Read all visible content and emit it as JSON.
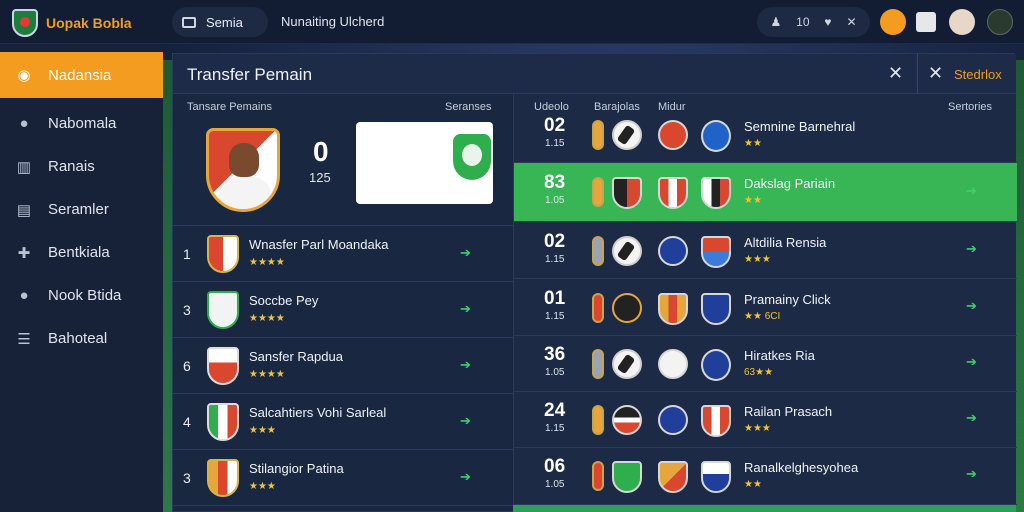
{
  "app": {
    "title": "Uopak Bobla"
  },
  "topbar": {
    "tab_label": "Semia",
    "title": "Nunaiting Ulcherd",
    "counter": "10"
  },
  "sidebar": {
    "items": [
      {
        "label": "Nadansia",
        "icon": "soccer-ball-icon",
        "active": true
      },
      {
        "label": "Nabomala",
        "icon": "person-icon"
      },
      {
        "label": "Ranais",
        "icon": "board-icon"
      },
      {
        "label": "Seramler",
        "icon": "document-icon"
      },
      {
        "label": "Bentkiala",
        "icon": "crossing-arrows-icon"
      },
      {
        "label": "Nook Btida",
        "icon": "person-icon"
      },
      {
        "label": "Bahoteal",
        "icon": "list-icon"
      }
    ]
  },
  "panel": {
    "title": "Transfer Pemain",
    "action_label": "Stedrlox"
  },
  "left": {
    "header": "Tansare Pemains",
    "header_right": "Seranses",
    "featured": {
      "score": "0",
      "sub": "125"
    },
    "rows": [
      {
        "rank": "1",
        "name": "Wnasfer Parl Moandaka",
        "stars": "★★★★"
      },
      {
        "rank": "3",
        "name": "Soccbe Pey",
        "stars": "★★★★"
      },
      {
        "rank": "6",
        "name": "Sansfer Rapdua",
        "stars": "★★★★"
      },
      {
        "rank": "4",
        "name": "Salcahtiers Vohi Sarleal",
        "stars": "★★★"
      },
      {
        "rank": "3",
        "name": "Stilangior Patina",
        "stars": "★★★"
      }
    ]
  },
  "right": {
    "headers": [
      "Udeolo",
      "Barajolas",
      "Midur",
      "Sertories"
    ],
    "rows": [
      {
        "score": "02",
        "rating": "1.15",
        "name": "Semnine Barnehral",
        "stars": "★★",
        "highlight": false
      },
      {
        "score": "83",
        "rating": "1.05",
        "name": "Dakslag Pariain",
        "stars": "★★",
        "highlight": true
      },
      {
        "score": "02",
        "rating": "1.15",
        "name": "Altdilia Rensia",
        "stars": "★★★",
        "highlight": false
      },
      {
        "score": "01",
        "rating": "1.15",
        "name": "Pramainy Click",
        "stars": "★★ 6CI",
        "highlight": false
      },
      {
        "score": "36",
        "rating": "1.05",
        "name": "Hiratkes Ria",
        "stars": "63★★",
        "highlight": false
      },
      {
        "score": "24",
        "rating": "1.15",
        "name": "Railan Prasach",
        "stars": "★★★",
        "highlight": false
      },
      {
        "score": "06",
        "rating": "1.05",
        "name": "Ranalkelghesyohea",
        "stars": "★★",
        "highlight": false
      }
    ]
  },
  "colors": {
    "accent": "#f39c1f",
    "highlight": "#38b554",
    "panel": "#1a2741",
    "arrow": "#3fd06a"
  }
}
